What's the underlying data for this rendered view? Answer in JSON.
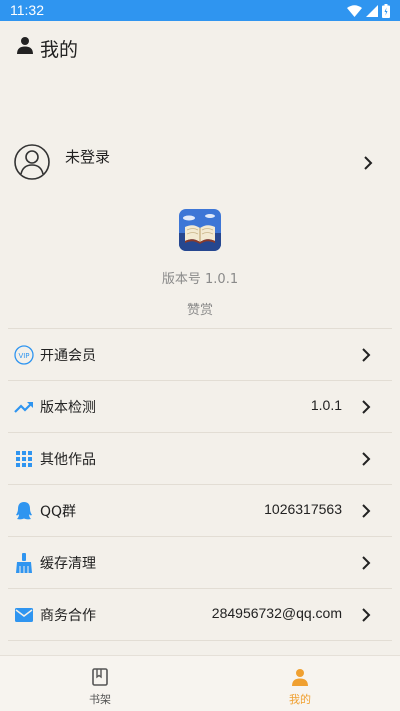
{
  "status_bar": {
    "time": "11:32"
  },
  "header": {
    "title": "我的"
  },
  "profile": {
    "login_text": "未登录"
  },
  "about": {
    "version": "版本号 1.0.1",
    "reward": "赞赏"
  },
  "menu": [
    {
      "label": "开通会员",
      "value": "",
      "icon": "vip-icon"
    },
    {
      "label": "版本检测",
      "value": "1.0.1",
      "icon": "trending-up-icon"
    },
    {
      "label": "其他作品",
      "value": "",
      "icon": "grid-icon"
    },
    {
      "label": "QQ群",
      "value": "1026317563",
      "icon": "qq-icon"
    },
    {
      "label": "缓存清理",
      "value": "",
      "icon": "broom-icon"
    },
    {
      "label": "商务合作",
      "value": "284956732@qq.com",
      "icon": "mail-icon"
    }
  ],
  "tabs": [
    {
      "label": "书架",
      "icon": "bookshelf-icon",
      "active": false
    },
    {
      "label": "我的",
      "icon": "person-icon",
      "active": true
    }
  ],
  "colors": {
    "accent": "#2f95f0",
    "active_tab": "#f0a030",
    "background": "#f3f0ea"
  }
}
